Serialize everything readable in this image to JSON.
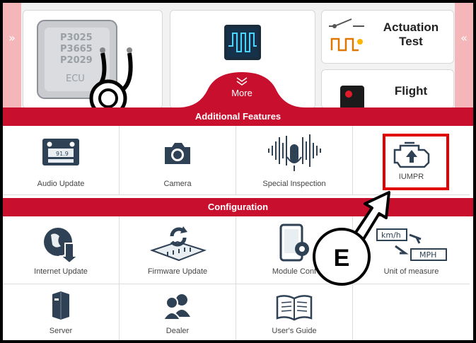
{
  "top": {
    "ecu_codes": [
      "P3025",
      "P3665",
      "P2029"
    ],
    "ecu_tag": "ECU",
    "actuation_title_line1": "Actuation",
    "actuation_title_line2": "Test",
    "flight_title": "Flight",
    "more_label": "More"
  },
  "sections": {
    "additional_features": "Additional Features",
    "configuration": "Configuration"
  },
  "features": [
    {
      "label": "Audio Update",
      "icon": "radio-icon",
      "display": "91.9"
    },
    {
      "label": "Camera",
      "icon": "camera-icon"
    },
    {
      "label": "Special Inspection",
      "icon": "microphone-wave-icon"
    },
    {
      "label": "IUMPR",
      "icon": "engine-check-icon"
    }
  ],
  "configuration": [
    {
      "label": "Internet Update",
      "icon": "globe-download-icon"
    },
    {
      "label": "Firmware Update",
      "icon": "chip-refresh-icon"
    },
    {
      "label": "Module Conf",
      "icon": "tablet-gear-icon"
    },
    {
      "label": "Unit of measure",
      "icon": "unit-convert-icon",
      "unit_from": "km/h",
      "unit_to": "MPH"
    },
    {
      "label": "Server",
      "icon": "server-icon"
    },
    {
      "label": "Dealer",
      "icon": "people-icon"
    },
    {
      "label": "User's Guide",
      "icon": "book-icon"
    }
  ],
  "callout": {
    "letter": "E"
  },
  "colors": {
    "accent": "#c8102e",
    "highlight": "#e00000"
  }
}
